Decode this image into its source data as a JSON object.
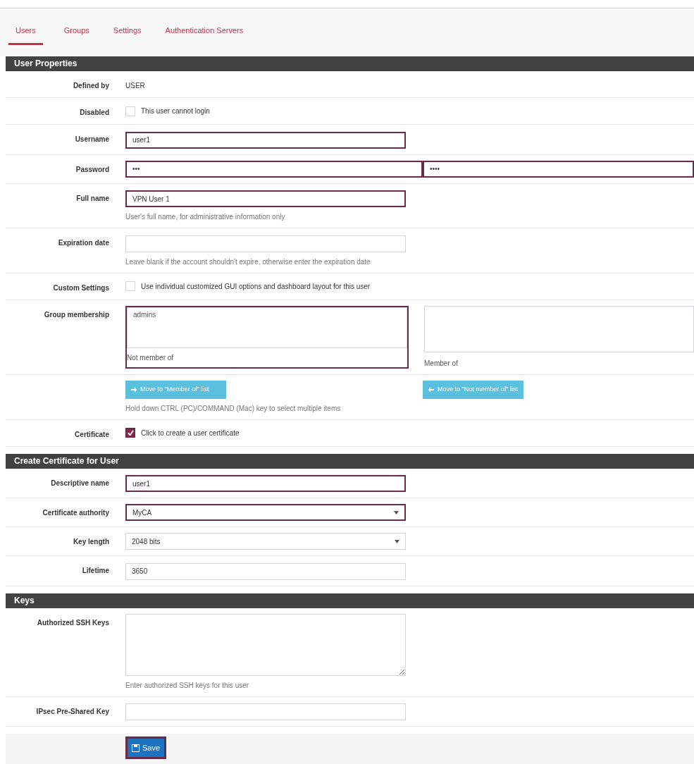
{
  "tabs": [
    {
      "label": "Users",
      "selected": true
    },
    {
      "label": "Groups",
      "selected": false
    },
    {
      "label": "Settings",
      "selected": false
    },
    {
      "label": "Authentication Servers",
      "selected": false
    }
  ],
  "sections": [
    {
      "title": "User Properties",
      "rows": [
        {
          "kind": "static",
          "label": "Defined by",
          "value": "USER"
        },
        {
          "kind": "checkbox",
          "label": "Disabled",
          "text": "This user cannot login",
          "checked": false,
          "highlighted": false
        },
        {
          "kind": "input",
          "label": "Username",
          "value": "user1",
          "highlighted": true
        },
        {
          "kind": "password",
          "label": "Password",
          "value": "•••",
          "confirm": "••••",
          "highlighted": true
        },
        {
          "kind": "input",
          "label": "Full name",
          "value": "VPN User 1",
          "help": "User's full name, for administrative information only",
          "highlighted": true
        },
        {
          "kind": "input",
          "label": "Expiration date",
          "help": "Leave blank if the account shouldn't expire, otherwise enter the expiration date",
          "highlighted": false
        },
        {
          "kind": "checkbox",
          "label": "Custom Settings",
          "text": "Use individual customized GUI options and dashboard layout for this user",
          "checked": false,
          "highlighted": false
        },
        {
          "kind": "groups",
          "label": "Group membership",
          "left_items": [
            "admins"
          ],
          "left_caption": "Not member of",
          "right_caption": "Member of",
          "highlighted": true
        },
        {
          "kind": "buttons",
          "buttons": [
            {
              "label": "Move to \"Member of\" list",
              "kind": "add"
            },
            {
              "label": "Move to \"Not member of\" list",
              "kind": "remove"
            }
          ],
          "help": "Hold down CTRL (PC)/COMMAND (Mac) key to select multiple items"
        },
        {
          "kind": "checkbox",
          "label": "Certificate",
          "text": "Click to create a user certificate",
          "checked": true,
          "highlighted": true
        }
      ]
    },
    {
      "title": "Create Certificate for User",
      "rows": [
        {
          "kind": "input",
          "label": "Descriptive name",
          "value": "user1",
          "highlighted": true
        },
        {
          "kind": "select",
          "label": "Certificate authority",
          "value": "MyCA",
          "highlighted": true
        },
        {
          "kind": "select",
          "label": "Key length",
          "value": "2048 bits",
          "highlighted": false
        },
        {
          "kind": "input",
          "label": "Lifetime",
          "value": "3650",
          "highlighted": false
        }
      ]
    },
    {
      "title": "Keys",
      "rows": [
        {
          "kind": "textarea",
          "label": "Authorized SSH Keys",
          "help": "Enter authorized SSH keys for this user",
          "highlighted": false
        },
        {
          "kind": "input",
          "label": "IPsec Pre-Shared Key",
          "highlighted": false
        }
      ]
    }
  ],
  "save": {
    "label": "Save",
    "highlighted": true
  }
}
